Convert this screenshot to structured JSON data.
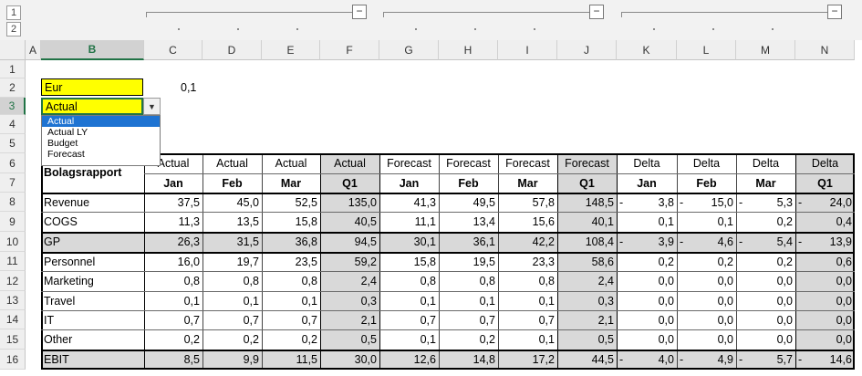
{
  "outline": {
    "levels": [
      "1",
      "2"
    ],
    "collapse_symbol": "−"
  },
  "columns": [
    "A",
    "B",
    "C",
    "D",
    "E",
    "F",
    "G",
    "H",
    "I",
    "J",
    "K",
    "L",
    "M",
    "N"
  ],
  "rows": [
    "1",
    "2",
    "3",
    "4",
    "5",
    "6",
    "7",
    "8",
    "9",
    "10",
    "11",
    "12",
    "13",
    "14",
    "15",
    "16"
  ],
  "inputs": {
    "currency": "Eur",
    "scenario": "Actual",
    "rate": "0,1"
  },
  "dropdown": {
    "options": [
      "Actual",
      "Actual LY",
      "Budget",
      "Forecast"
    ],
    "selected": "Actual"
  },
  "report": {
    "title": "Bolagsrapport",
    "header_top": [
      "Actual",
      "Actual",
      "Actual",
      "Actual",
      "Forecast",
      "Forecast",
      "Forecast",
      "Forecast",
      "Delta",
      "Delta",
      "Delta",
      "Delta"
    ],
    "header_bottom": [
      "Jan",
      "Feb",
      "Mar",
      "Q1",
      "Jan",
      "Feb",
      "Mar",
      "Q1",
      "Jan",
      "Feb",
      "Mar",
      "Q1"
    ],
    "rows": [
      {
        "label": "Revenue",
        "values": [
          "37,5",
          "45,0",
          "52,5",
          "135,0",
          "41,3",
          "49,5",
          "57,8",
          "148,5",
          "3,8",
          "15,0",
          "5,3",
          "24,0"
        ],
        "neg": [
          false,
          false,
          false,
          false,
          false,
          false,
          false,
          false,
          true,
          true,
          true,
          true
        ]
      },
      {
        "label": "COGS",
        "values": [
          "11,3",
          "13,5",
          "15,8",
          "40,5",
          "11,1",
          "13,4",
          "15,6",
          "40,1",
          "0,1",
          "0,1",
          "0,2",
          "0,4"
        ],
        "neg": [
          false,
          false,
          false,
          false,
          false,
          false,
          false,
          false,
          false,
          false,
          false,
          false
        ]
      },
      {
        "label": "GP",
        "values": [
          "26,3",
          "31,5",
          "36,8",
          "94,5",
          "30,1",
          "36,1",
          "42,2",
          "108,4",
          "3,9",
          "4,6",
          "5,4",
          "13,9"
        ],
        "neg": [
          false,
          false,
          false,
          false,
          false,
          false,
          false,
          false,
          true,
          true,
          true,
          true
        ]
      },
      {
        "label": "Personnel",
        "values": [
          "16,0",
          "19,7",
          "23,5",
          "59,2",
          "15,8",
          "19,5",
          "23,3",
          "58,6",
          "0,2",
          "0,2",
          "0,2",
          "0,6"
        ],
        "neg": [
          false,
          false,
          false,
          false,
          false,
          false,
          false,
          false,
          false,
          false,
          false,
          false
        ]
      },
      {
        "label": "Marketing",
        "values": [
          "0,8",
          "0,8",
          "0,8",
          "2,4",
          "0,8",
          "0,8",
          "0,8",
          "2,4",
          "0,0",
          "0,0",
          "0,0",
          "0,0"
        ],
        "neg": [
          false,
          false,
          false,
          false,
          false,
          false,
          false,
          false,
          false,
          false,
          false,
          false
        ]
      },
      {
        "label": "Travel",
        "values": [
          "0,1",
          "0,1",
          "0,1",
          "0,3",
          "0,1",
          "0,1",
          "0,1",
          "0,3",
          "0,0",
          "0,0",
          "0,0",
          "0,0"
        ],
        "neg": [
          false,
          false,
          false,
          false,
          false,
          false,
          false,
          false,
          false,
          false,
          false,
          false
        ]
      },
      {
        "label": "IT",
        "values": [
          "0,7",
          "0,7",
          "0,7",
          "2,1",
          "0,7",
          "0,7",
          "0,7",
          "2,1",
          "0,0",
          "0,0",
          "0,0",
          "0,0"
        ],
        "neg": [
          false,
          false,
          false,
          false,
          false,
          false,
          false,
          false,
          false,
          false,
          false,
          false
        ]
      },
      {
        "label": "Other",
        "values": [
          "0,2",
          "0,2",
          "0,2",
          "0,5",
          "0,1",
          "0,2",
          "0,1",
          "0,5",
          "0,0",
          "0,0",
          "0,0",
          "0,0"
        ],
        "neg": [
          false,
          false,
          false,
          false,
          false,
          false,
          false,
          false,
          false,
          false,
          false,
          false
        ]
      },
      {
        "label": "EBIT",
        "values": [
          "8,5",
          "9,9",
          "11,5",
          "30,0",
          "12,6",
          "14,8",
          "17,2",
          "44,5",
          "4,0",
          "4,9",
          "5,7",
          "14,6"
        ],
        "neg": [
          false,
          false,
          false,
          false,
          false,
          false,
          false,
          false,
          true,
          true,
          true,
          true
        ]
      }
    ],
    "neg_sign": "-"
  }
}
